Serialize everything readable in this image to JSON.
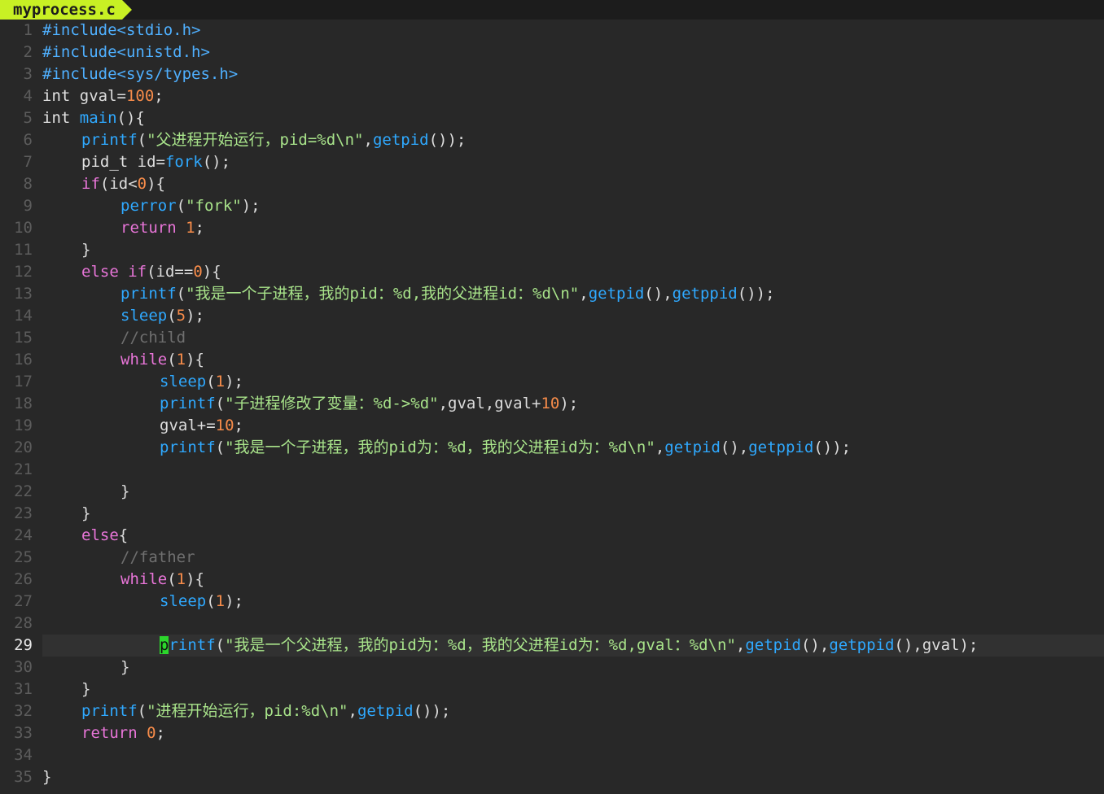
{
  "tab": {
    "title": "myprocess.c"
  },
  "editor": {
    "current_line": 29,
    "lines": [
      {
        "n": "1",
        "indent": 0,
        "tokens": [
          [
            "#include<stdio.h>",
            "pre"
          ]
        ]
      },
      {
        "n": "2",
        "indent": 0,
        "tokens": [
          [
            "#include<unistd.h>",
            "pre"
          ]
        ]
      },
      {
        "n": "3",
        "indent": 0,
        "tokens": [
          [
            "#include<sys/types.h>",
            "pre"
          ]
        ]
      },
      {
        "n": "4",
        "indent": 0,
        "tokens": [
          [
            "int",
            "type"
          ],
          [
            " gval=",
            "plain"
          ],
          [
            "100",
            "num"
          ],
          [
            ";",
            "plain"
          ]
        ]
      },
      {
        "n": "5",
        "indent": 0,
        "tokens": [
          [
            "int",
            "type"
          ],
          [
            " ",
            "plain"
          ],
          [
            "main",
            "func"
          ],
          [
            "(){",
            "plain"
          ]
        ]
      },
      {
        "n": "6",
        "indent": 1,
        "tokens": [
          [
            "printf",
            "func"
          ],
          [
            "(",
            "plain"
          ],
          [
            "\"父进程开始运行，pid=%d\\n\"",
            "str"
          ],
          [
            ",",
            "plain"
          ],
          [
            "getpid",
            "func"
          ],
          [
            "());",
            "plain"
          ]
        ]
      },
      {
        "n": "7",
        "indent": 1,
        "tokens": [
          [
            "pid_t",
            "type"
          ],
          [
            " id=",
            "plain"
          ],
          [
            "fork",
            "func"
          ],
          [
            "();",
            "plain"
          ]
        ]
      },
      {
        "n": "8",
        "indent": 1,
        "tokens": [
          [
            "if",
            "kw"
          ],
          [
            "(id<",
            "plain"
          ],
          [
            "0",
            "num"
          ],
          [
            "){",
            "plain"
          ]
        ]
      },
      {
        "n": "9",
        "indent": 2,
        "tokens": [
          [
            "perror",
            "func"
          ],
          [
            "(",
            "plain"
          ],
          [
            "\"fork\"",
            "str"
          ],
          [
            ");",
            "plain"
          ]
        ]
      },
      {
        "n": "10",
        "indent": 2,
        "tokens": [
          [
            "return",
            "kw"
          ],
          [
            " ",
            "plain"
          ],
          [
            "1",
            "num"
          ],
          [
            ";",
            "plain"
          ]
        ]
      },
      {
        "n": "11",
        "indent": 1,
        "tokens": [
          [
            "}",
            "plain"
          ]
        ]
      },
      {
        "n": "12",
        "indent": 1,
        "tokens": [
          [
            "else",
            "kw"
          ],
          [
            " ",
            "plain"
          ],
          [
            "if",
            "kw"
          ],
          [
            "(id==",
            "plain"
          ],
          [
            "0",
            "num"
          ],
          [
            "){",
            "plain"
          ]
        ]
      },
      {
        "n": "13",
        "indent": 2,
        "tokens": [
          [
            "printf",
            "func"
          ],
          [
            "(",
            "plain"
          ],
          [
            "\"我是一个子进程，我的pid：%d,我的父进程id：%d\\n\"",
            "str"
          ],
          [
            ",",
            "plain"
          ],
          [
            "getpid",
            "func"
          ],
          [
            "(),",
            "plain"
          ],
          [
            "getppid",
            "func"
          ],
          [
            "());",
            "plain"
          ]
        ]
      },
      {
        "n": "14",
        "indent": 2,
        "tokens": [
          [
            "sleep",
            "func"
          ],
          [
            "(",
            "plain"
          ],
          [
            "5",
            "num"
          ],
          [
            ");",
            "plain"
          ]
        ]
      },
      {
        "n": "15",
        "indent": 2,
        "tokens": [
          [
            "//child",
            "com"
          ]
        ]
      },
      {
        "n": "16",
        "indent": 2,
        "tokens": [
          [
            "while",
            "kw"
          ],
          [
            "(",
            "plain"
          ],
          [
            "1",
            "num"
          ],
          [
            "){",
            "plain"
          ]
        ]
      },
      {
        "n": "17",
        "indent": 3,
        "tokens": [
          [
            "sleep",
            "func"
          ],
          [
            "(",
            "plain"
          ],
          [
            "1",
            "num"
          ],
          [
            ");",
            "plain"
          ]
        ]
      },
      {
        "n": "18",
        "indent": 3,
        "tokens": [
          [
            "printf",
            "func"
          ],
          [
            "(",
            "plain"
          ],
          [
            "\"子进程修改了变量：%d->%d\"",
            "str"
          ],
          [
            ",gval,gval+",
            "plain"
          ],
          [
            "10",
            "num"
          ],
          [
            ");",
            "plain"
          ]
        ]
      },
      {
        "n": "19",
        "indent": 3,
        "tokens": [
          [
            "gval+=",
            "plain"
          ],
          [
            "10",
            "num"
          ],
          [
            ";",
            "plain"
          ]
        ]
      },
      {
        "n": "20",
        "indent": 3,
        "tokens": [
          [
            "printf",
            "func"
          ],
          [
            "(",
            "plain"
          ],
          [
            "\"我是一个子进程，我的pid为：%d，我的父进程id为：%d\\n\"",
            "str"
          ],
          [
            ",",
            "plain"
          ],
          [
            "getpid",
            "func"
          ],
          [
            "(),",
            "plain"
          ],
          [
            "getppid",
            "func"
          ],
          [
            "());",
            "plain"
          ]
        ]
      },
      {
        "n": "21",
        "indent": 0,
        "tokens": []
      },
      {
        "n": "22",
        "indent": 2,
        "tokens": [
          [
            "}",
            "plain"
          ]
        ]
      },
      {
        "n": "23",
        "indent": 1,
        "tokens": [
          [
            "}",
            "plain"
          ]
        ]
      },
      {
        "n": "24",
        "indent": 1,
        "tokens": [
          [
            "else",
            "kw"
          ],
          [
            "{",
            "plain"
          ]
        ]
      },
      {
        "n": "25",
        "indent": 2,
        "tokens": [
          [
            "//father",
            "com"
          ]
        ]
      },
      {
        "n": "26",
        "indent": 2,
        "tokens": [
          [
            "while",
            "kw"
          ],
          [
            "(",
            "plain"
          ],
          [
            "1",
            "num"
          ],
          [
            "){",
            "plain"
          ]
        ]
      },
      {
        "n": "27",
        "indent": 3,
        "tokens": [
          [
            "sleep",
            "func"
          ],
          [
            "(",
            "plain"
          ],
          [
            "1",
            "num"
          ],
          [
            ");",
            "plain"
          ]
        ]
      },
      {
        "n": "28",
        "indent": 0,
        "tokens": []
      },
      {
        "n": "29",
        "indent": 3,
        "tokens": [
          [
            "p",
            "cursor"
          ],
          [
            "rintf",
            "func"
          ],
          [
            "(",
            "plain"
          ],
          [
            "\"我是一个父进程，我的pid为：%d，我的父进程id为：%d,gval：%d\\n\"",
            "str"
          ],
          [
            ",",
            "plain"
          ],
          [
            "getpid",
            "func"
          ],
          [
            "(),",
            "plain"
          ],
          [
            "getppid",
            "func"
          ],
          [
            "(),gval);",
            "plain"
          ]
        ]
      },
      {
        "n": "30",
        "indent": 2,
        "tokens": [
          [
            "}",
            "plain"
          ]
        ]
      },
      {
        "n": "31",
        "indent": 1,
        "tokens": [
          [
            "}",
            "plain"
          ]
        ]
      },
      {
        "n": "32",
        "indent": 1,
        "tokens": [
          [
            "printf",
            "func"
          ],
          [
            "(",
            "plain"
          ],
          [
            "\"进程开始运行，pid:%d\\n\"",
            "str"
          ],
          [
            ",",
            "plain"
          ],
          [
            "getpid",
            "func"
          ],
          [
            "());",
            "plain"
          ]
        ]
      },
      {
        "n": "33",
        "indent": 1,
        "tokens": [
          [
            "return",
            "kw"
          ],
          [
            " ",
            "plain"
          ],
          [
            "0",
            "num"
          ],
          [
            ";",
            "plain"
          ]
        ]
      },
      {
        "n": "34",
        "indent": 0,
        "tokens": []
      },
      {
        "n": "35",
        "indent": 0,
        "tokens": [
          [
            "}",
            "plain"
          ]
        ]
      }
    ]
  },
  "colors": {
    "background": "#282828",
    "tab_accent": "#c8f024",
    "cursor": "#2cd62c",
    "preprocessor": "#4fb0ff",
    "function": "#2fa9ff",
    "string": "#a8e38a",
    "number": "#f78c4a",
    "keyword": "#e875d8",
    "comment": "#6f6f6f"
  }
}
